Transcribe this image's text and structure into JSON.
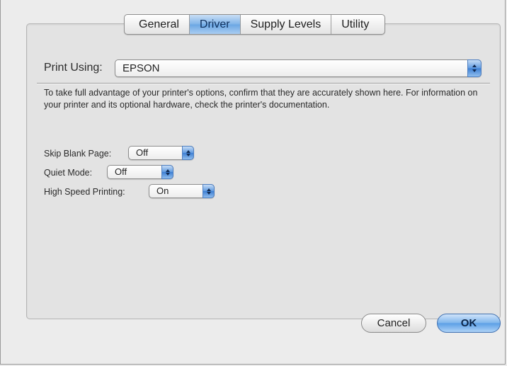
{
  "tabs": [
    {
      "label": "General",
      "active": false
    },
    {
      "label": "Driver",
      "active": true
    },
    {
      "label": "Supply Levels",
      "active": false
    },
    {
      "label": "Utility",
      "active": false
    }
  ],
  "print_using": {
    "label": "Print Using:",
    "value": "EPSON"
  },
  "description": "To take full advantage of your printer's options, confirm that they are accurately shown here. For information on your printer and its optional hardware, check the printer's documentation.",
  "options": [
    {
      "label": "Skip Blank Page:",
      "value": "Off"
    },
    {
      "label": "Quiet Mode:",
      "value": "Off"
    },
    {
      "label": "High Speed Printing:",
      "value": "On"
    }
  ],
  "buttons": {
    "cancel": "Cancel",
    "ok": "OK"
  },
  "colors": {
    "accent": "#6aa6e3",
    "background": "#ececec"
  }
}
